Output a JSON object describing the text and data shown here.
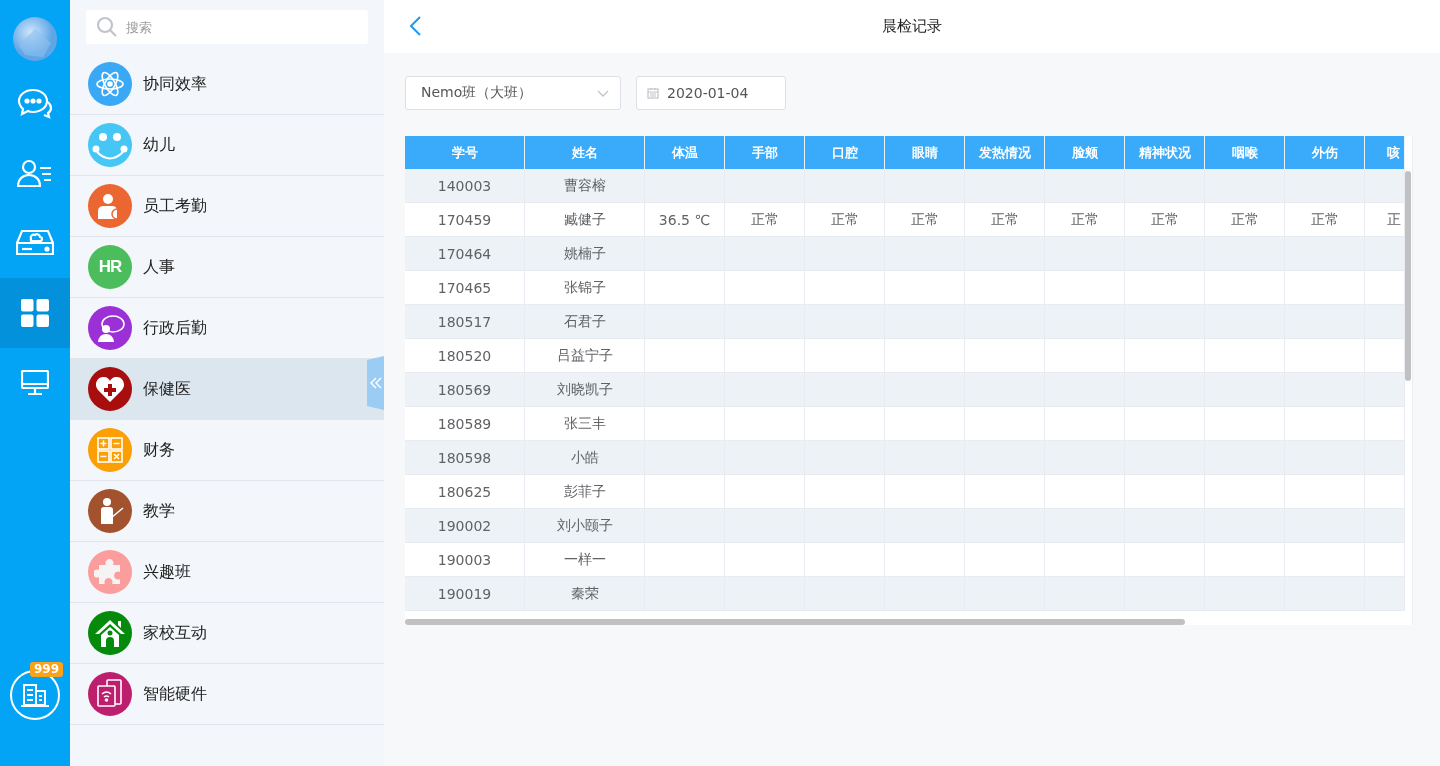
{
  "rail": {
    "items": [
      {
        "kind": "chat",
        "selected": false
      },
      {
        "kind": "contacts",
        "selected": false
      },
      {
        "kind": "drive",
        "selected": false
      },
      {
        "kind": "apps",
        "selected": true
      },
      {
        "kind": "desktop",
        "selected": false
      }
    ],
    "badge": "999"
  },
  "sidebar": {
    "search": {
      "placeholder": "搜索"
    },
    "items": [
      {
        "label": "协同效率",
        "kind": "atom",
        "color": "#3aa9f5",
        "selected": false
      },
      {
        "label": "幼儿",
        "kind": "smiley",
        "color": "#45c6f5",
        "selected": false
      },
      {
        "label": "员工考勤",
        "kind": "staff",
        "color": "#ec6632",
        "selected": false
      },
      {
        "label": "人事",
        "kind": "text",
        "icon_text": "HR",
        "color": "#4cbd5d",
        "selected": false
      },
      {
        "label": "行政后勤",
        "kind": "admin",
        "color": "#9a30d6",
        "selected": false
      },
      {
        "label": "保健医",
        "kind": "health",
        "color": "#a80e0e",
        "selected": true
      },
      {
        "label": "财务",
        "kind": "finance",
        "color": "#fb9f05",
        "selected": false
      },
      {
        "label": "教学",
        "kind": "teaching",
        "color": "#a2522c",
        "selected": false
      },
      {
        "label": "兴趣班",
        "kind": "puzzle",
        "color": "#fb9d9c",
        "selected": false
      },
      {
        "label": "家校互动",
        "kind": "house",
        "color": "#068a0b",
        "selected": false
      },
      {
        "label": "智能硬件",
        "kind": "device",
        "color": "#bd1f6e",
        "selected": false
      }
    ]
  },
  "header": {
    "title": "晨检记录"
  },
  "filters": {
    "class_select": "Nemo班（大班）",
    "date": "2020-01-04"
  },
  "table": {
    "columns": [
      "学号",
      "姓名",
      "体温",
      "手部",
      "口腔",
      "眼睛",
      "发热情况",
      "脸颊",
      "精神状况",
      "咽喉",
      "外伤",
      "咳"
    ],
    "rows": [
      {
        "id": "140003",
        "name": "曹容榕"
      },
      {
        "id": "170459",
        "name": "臧健子",
        "values": [
          "36.5 ℃",
          "正常",
          "正常",
          "正常",
          "正常",
          "正常",
          "正常",
          "正常",
          "正常",
          "正"
        ]
      },
      {
        "id": "170464",
        "name": "姚楠子"
      },
      {
        "id": "170465",
        "name": "张锦子"
      },
      {
        "id": "180517",
        "name": "石君子"
      },
      {
        "id": "180520",
        "name": "吕益宁子"
      },
      {
        "id": "180569",
        "name": "刘晓凯子"
      },
      {
        "id": "180589",
        "name": "张三丰"
      },
      {
        "id": "180598",
        "name": "小皓"
      },
      {
        "id": "180625",
        "name": "彭菲子"
      },
      {
        "id": "190002",
        "name": "刘小颐子"
      },
      {
        "id": "190003",
        "name": "一样一"
      },
      {
        "id": "190019",
        "name": "秦荣"
      }
    ]
  }
}
